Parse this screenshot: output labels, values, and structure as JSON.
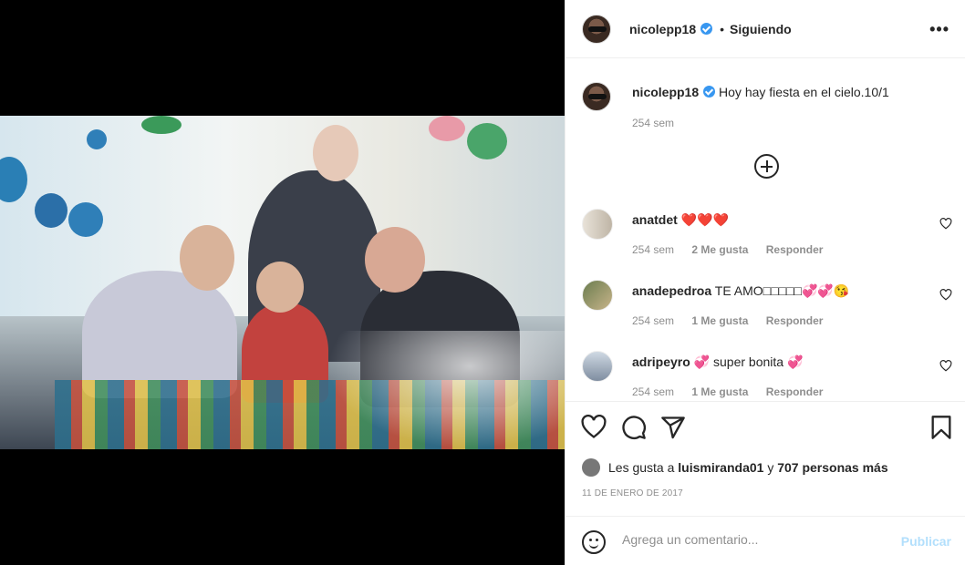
{
  "post": {
    "author": "nicolepp18",
    "follow_status": "Siguiendo",
    "separator": "•",
    "more_label": "•••"
  },
  "caption": {
    "username": "nicolepp18",
    "text": "Hoy hay fiesta en el cielo.10/1",
    "time": "254 sem"
  },
  "comments": [
    {
      "username": "anatdet",
      "text": "❤️❤️❤️",
      "time": "254 sem",
      "likes": "2 Me gusta",
      "reply": "Responder"
    },
    {
      "username": "anadepedroa",
      "text": "TE AMO□□□□□💞💞😘",
      "time": "254 sem",
      "likes": "1 Me gusta",
      "reply": "Responder"
    },
    {
      "username": "adripeyro",
      "text": "💞 super bonita 💞",
      "time": "254 sem",
      "likes": "1 Me gusta",
      "reply": "Responder"
    }
  ],
  "likes": {
    "prefix": "Les gusta a",
    "user": "luismiranda01",
    "conjunction": "y",
    "others": "707 personas más"
  },
  "date": "11 DE ENERO DE 2017",
  "composer": {
    "placeholder": "Agrega un comentario...",
    "publish": "Publicar"
  },
  "icons": {
    "like": "heart-icon",
    "comment": "comment-icon",
    "share": "paper-plane-icon",
    "save": "bookmark-icon",
    "emoji": "emoji-icon",
    "add": "plus-circle-icon"
  },
  "colors": {
    "verified": "#3897f0",
    "publish_disabled": "#b2dffc",
    "muted_text": "#8e8e8e"
  }
}
